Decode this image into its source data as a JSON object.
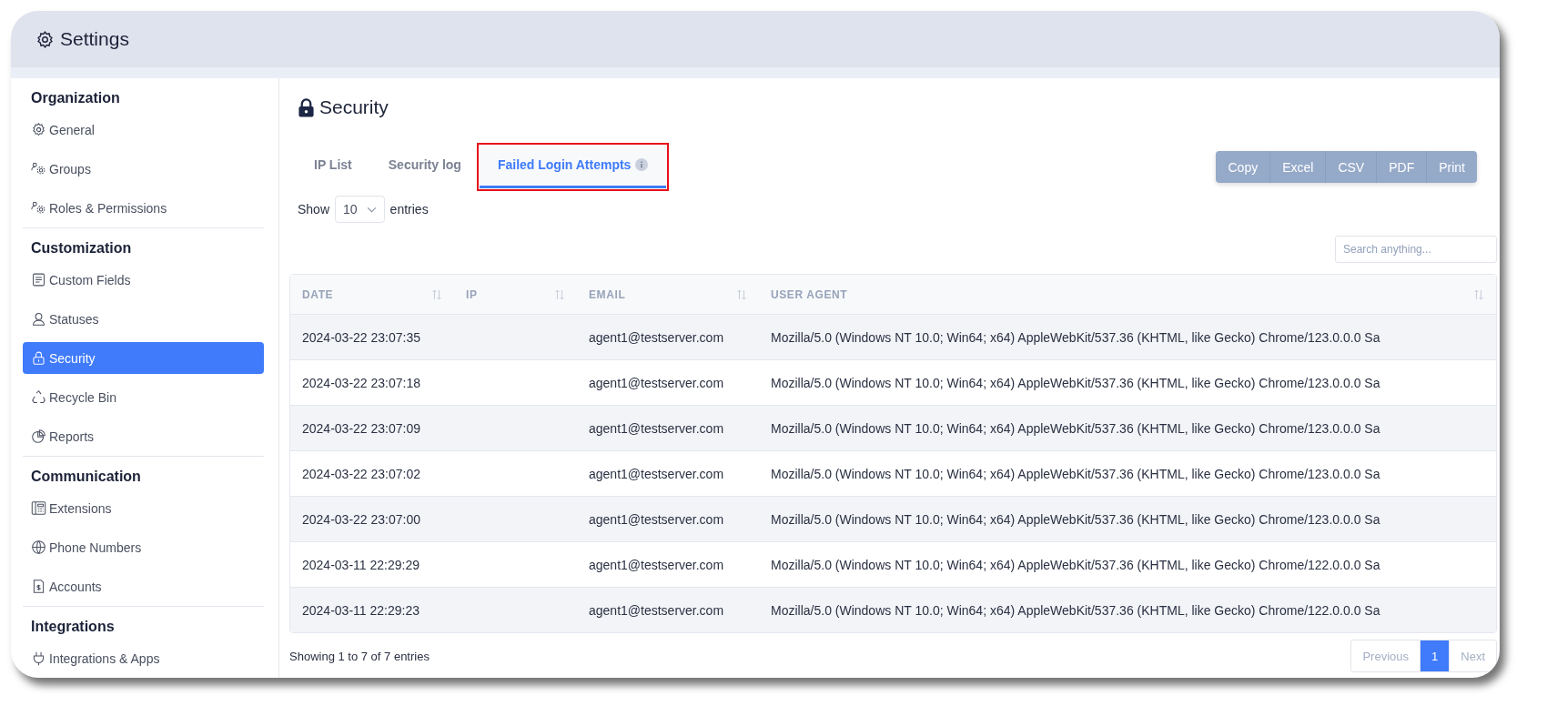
{
  "header": {
    "title": "Settings"
  },
  "sidebar": {
    "sections": [
      {
        "heading": "Organization",
        "items": [
          {
            "label": "General",
            "selected": false
          },
          {
            "label": "Groups",
            "selected": false
          },
          {
            "label": "Roles & Permissions",
            "selected": false
          }
        ]
      },
      {
        "heading": "Customization",
        "items": [
          {
            "label": "Custom Fields",
            "selected": false
          },
          {
            "label": "Statuses",
            "selected": false
          },
          {
            "label": "Security",
            "selected": true
          },
          {
            "label": "Recycle Bin",
            "selected": false
          },
          {
            "label": "Reports",
            "selected": false
          }
        ]
      },
      {
        "heading": "Communication",
        "items": [
          {
            "label": "Extensions",
            "selected": false
          },
          {
            "label": "Phone Numbers",
            "selected": false
          },
          {
            "label": "Accounts",
            "selected": false
          }
        ]
      },
      {
        "heading": "Integrations",
        "items": [
          {
            "label": "Integrations & Apps",
            "selected": false
          }
        ]
      }
    ]
  },
  "page": {
    "title": "Security"
  },
  "tabs": [
    {
      "label": "IP List",
      "selected": false
    },
    {
      "label": "Security log",
      "selected": false
    },
    {
      "label": "Failed Login Attempts",
      "selected": true,
      "highlighted": true
    }
  ],
  "export_buttons": [
    "Copy",
    "Excel",
    "CSV",
    "PDF",
    "Print"
  ],
  "length": {
    "before": "Show",
    "value": "10",
    "after": "entries"
  },
  "search": {
    "placeholder": "Search anything..."
  },
  "table": {
    "columns": [
      "DATE",
      "IP",
      "EMAIL",
      "USER AGENT"
    ],
    "rows": [
      {
        "date": "2024-03-22 23:07:35",
        "email": "agent1@testserver.com",
        "user_agent": "Mozilla/5.0 (Windows NT 10.0; Win64; x64) AppleWebKit/537.36 (KHTML, like Gecko) Chrome/123.0.0.0 Sa"
      },
      {
        "date": "2024-03-22 23:07:18",
        "email": "agent1@testserver.com",
        "user_agent": "Mozilla/5.0 (Windows NT 10.0; Win64; x64) AppleWebKit/537.36 (KHTML, like Gecko) Chrome/123.0.0.0 Sa"
      },
      {
        "date": "2024-03-22 23:07:09",
        "email": "agent1@testserver.com",
        "user_agent": "Mozilla/5.0 (Windows NT 10.0; Win64; x64) AppleWebKit/537.36 (KHTML, like Gecko) Chrome/123.0.0.0 Sa"
      },
      {
        "date": "2024-03-22 23:07:02",
        "email": "agent1@testserver.com",
        "user_agent": "Mozilla/5.0 (Windows NT 10.0; Win64; x64) AppleWebKit/537.36 (KHTML, like Gecko) Chrome/123.0.0.0 Sa"
      },
      {
        "date": "2024-03-22 23:07:00",
        "email": "agent1@testserver.com",
        "user_agent": "Mozilla/5.0 (Windows NT 10.0; Win64; x64) AppleWebKit/537.36 (KHTML, like Gecko) Chrome/123.0.0.0 Sa"
      },
      {
        "date": "2024-03-11 22:29:29",
        "email": "agent1@testserver.com",
        "user_agent": "Mozilla/5.0 (Windows NT 10.0; Win64; x64) AppleWebKit/537.36 (KHTML, like Gecko) Chrome/122.0.0.0 Sa"
      },
      {
        "date": "2024-03-11 22:29:23",
        "email": "agent1@testserver.com",
        "user_agent": "Mozilla/5.0 (Windows NT 10.0; Win64; x64) AppleWebKit/537.36 (KHTML, like Gecko) Chrome/122.0.0.0 Sa"
      }
    ]
  },
  "footer": {
    "info": "Showing 1 to 7 of 7 entries"
  },
  "pagination": [
    {
      "label": "Previous",
      "selected": false,
      "disabled": true
    },
    {
      "label": "1",
      "selected": true,
      "disabled": false
    },
    {
      "label": "Next",
      "selected": false,
      "disabled": true
    }
  ]
}
